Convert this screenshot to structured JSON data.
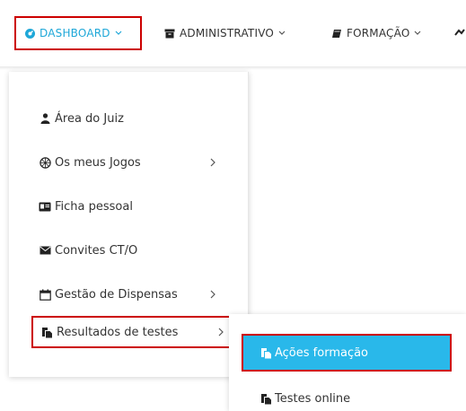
{
  "colors": {
    "accent": "#1ea7d8",
    "active_bg": "#29b8ea",
    "highlight_border": "#cc0000",
    "text": "#333333"
  },
  "nav": {
    "dashboard": {
      "label": "DASHBOARD",
      "icon": "dashboard-icon"
    },
    "admin": {
      "label": "ADMINISTRATIVO",
      "icon": "archive-icon"
    },
    "formacao": {
      "label": "FORMAÇÃO",
      "icon": "book-icon"
    }
  },
  "menu": {
    "items": [
      {
        "label": "Área do Juiz",
        "icon": "user-icon",
        "submenu": false
      },
      {
        "label": "Os meus Jogos",
        "icon": "soccer-ball-icon",
        "submenu": true
      },
      {
        "label": "Ficha pessoal",
        "icon": "id-card-icon",
        "submenu": false
      },
      {
        "label": "Convites CT/O",
        "icon": "envelope-icon",
        "submenu": false
      },
      {
        "label": "Gestão de Dispensas",
        "icon": "calendar-icon",
        "submenu": true
      },
      {
        "label": "Resultados de testes",
        "icon": "copy-icon",
        "submenu": true
      }
    ]
  },
  "submenu": {
    "items": [
      {
        "label": "Ações formação",
        "icon": "copy-icon",
        "active": true
      },
      {
        "label": "Testes online",
        "icon": "copy-icon",
        "active": false
      }
    ]
  }
}
